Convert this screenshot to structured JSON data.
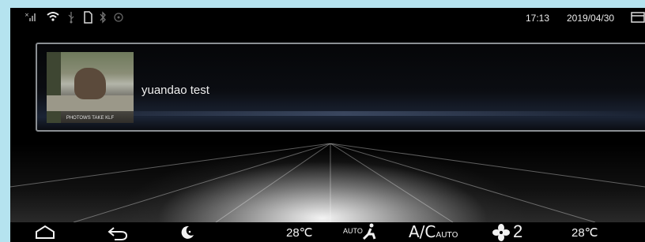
{
  "statusbar": {
    "time": "17:13",
    "date": "2019/04/30"
  },
  "media": {
    "title": "yuandao test",
    "thumbnail_caption": "PHOTOWS TAKE KLF"
  },
  "climate": {
    "left_temp": "28℃",
    "right_temp": "28℃",
    "seat_mode": "AUTO",
    "ac_label": "A/C",
    "ac_sub": "AUTO",
    "fan_level": "2"
  },
  "colors": {
    "screen_bg": "#000000",
    "frame_bg": "#b5e3ef",
    "card_border": "#8b8f93"
  }
}
